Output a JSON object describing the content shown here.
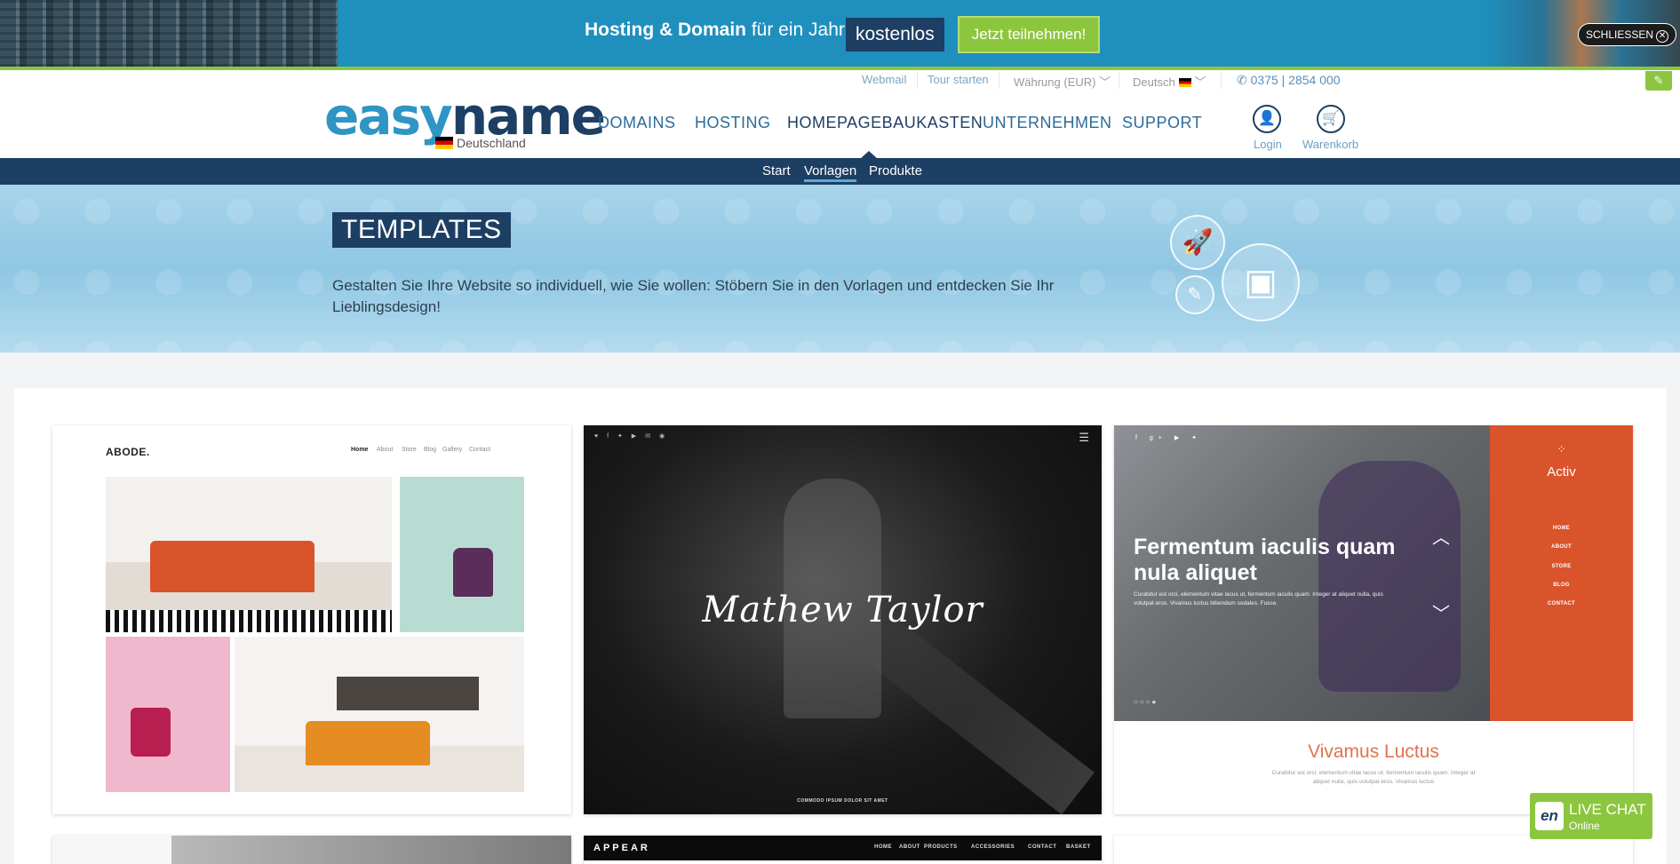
{
  "promo": {
    "headline_bold": "Hosting & Domain",
    "headline_rest": " für ein Jahr",
    "highlight": "kostenlos",
    "cta": "Jetzt teilnehmen!",
    "close": "SCHLIESSEN"
  },
  "topbar": {
    "webmail": "Webmail",
    "tour": "Tour starten",
    "currency": "Währung (EUR)",
    "language": "Deutsch",
    "phone": "0375 | 2854 000"
  },
  "logo": {
    "part1": "easy",
    "part2": "name",
    "country": "Deutschland"
  },
  "nav": {
    "items": [
      {
        "label": "DOMAINS"
      },
      {
        "label": "HOSTING"
      },
      {
        "label": "HOMEPAGEBAUKASTEN"
      },
      {
        "label": "UNTERNEHMEN"
      },
      {
        "label": "SUPPORT"
      }
    ],
    "active": "HOMEPAGEBAUKASTEN",
    "login": "Login",
    "cart": "Warenkorb"
  },
  "subnav": {
    "items": [
      {
        "label": "Start"
      },
      {
        "label": "Vorlagen"
      },
      {
        "label": "Produkte"
      }
    ],
    "active": "Vorlagen"
  },
  "hero": {
    "title": "TEMPLATES",
    "text": "Gestalten Sie Ihre Website so individuell, wie Sie wollen: Stöbern Sie in den Vorlagen und entdecken Sie Ihr Lieblingsdesign!"
  },
  "templates": [
    {
      "logo": "ABODE.",
      "menu": [
        "Home",
        "About",
        "Store",
        "Blog",
        "Gallery",
        "Contact"
      ]
    },
    {
      "name": "Mathew Taylor",
      "footer": "COMMODO IPSUM DOLOR SIT AMET"
    },
    {
      "brand": "Activ",
      "menu": [
        "HOME",
        "ABOUT",
        "STORE",
        "BLOG",
        "CONTACT"
      ],
      "headline": "Fermentum iaculis quam nula aliquet",
      "subtext": "Curabitur est orci, elementum vitae lacus ut, fermentum iaculis quam. Integer at aliquet nulla, quis volutpat eros. Vivamus luctus bibendum sodales. Fusce.",
      "title": "Vivamus Luctus",
      "text": "Curabitur est orci, elementum vitae lacus ut, fermentum iaculis quam. Integer at aliquet nulla, quis volutpat eros. Vivamus luctus"
    },
    {
      "logo": "APPEAR",
      "menu": [
        "HOME",
        "ABOUT",
        "PRODUCTS",
        "ACCESSORIES",
        "CONTACT",
        "BASKET"
      ]
    }
  ],
  "chat": {
    "title": "LIVE CHAT",
    "status": "Online",
    "logo": "en"
  },
  "icons": {
    "promo_close": "close-circle-icon",
    "phone": "phone-icon",
    "login": "user-icon",
    "cart": "cart-icon",
    "hero": [
      "rocket-icon",
      "brush-icon",
      "browser-window-icon"
    ]
  },
  "colors": {
    "brand_dark": "#1d3f63",
    "brand_light": "#2f95c4",
    "accent_green": "#8cc63f",
    "promo_bg": "#1f8fbe",
    "activ_orange": "#d9532b"
  }
}
